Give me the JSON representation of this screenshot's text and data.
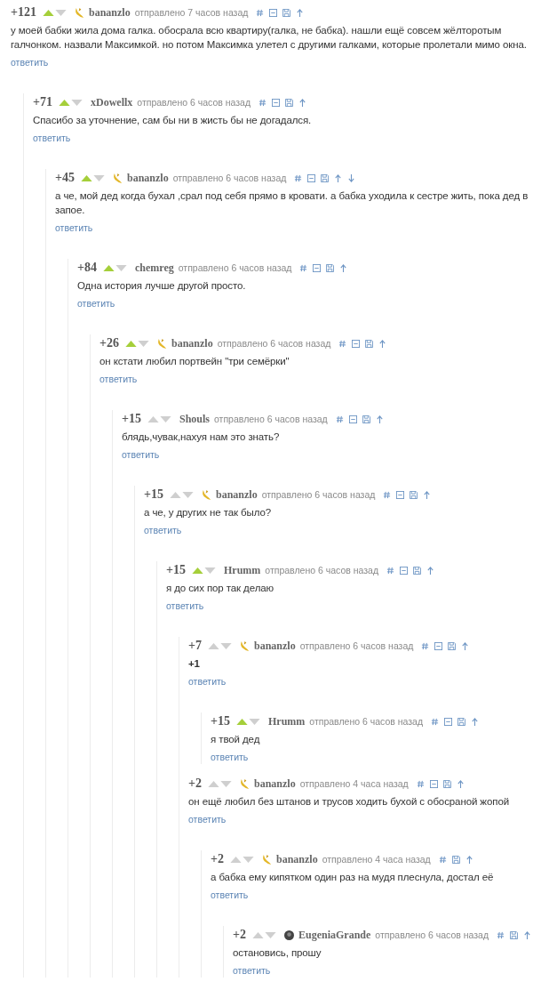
{
  "comments": [
    {
      "score": "+121",
      "upvoted": true,
      "author": "bananzlo",
      "banana": true,
      "time": "отправлено 7 часов назад",
      "collapse": true,
      "text": "у моей бабки жила дома галка. обосрала всю квартиру(галка, не бабка). нашли ещё совсем жёлторотым галчонком. назвали Максимкой. но потом Максимка улетел с другими галками, которые пролетали мимо окна.",
      "reply": "ответить",
      "children": [
        {
          "score": "+71",
          "upvoted": true,
          "author": "xDowellx",
          "time": "отправлено 6 часов назад",
          "collapse": true,
          "text": "Спасибо за уточнение, сам бы ни в жисть бы не догадался.",
          "reply": "ответить",
          "children": [
            {
              "score": "+45",
              "upvoted": true,
              "author": "bananzlo",
              "banana": true,
              "time": "отправлено 6 часов назад",
              "collapse": true,
              "next": true,
              "text": "а че, мой дед когда бухал ,срал под себя прямо в кровати. а бабка уходила к сестре жить, пока дед в запое.",
              "reply": "ответить",
              "children": [
                {
                  "score": "+84",
                  "upvoted": true,
                  "author": "chemreg",
                  "time": "отправлено 6 часов назад",
                  "collapse": true,
                  "text": "Одна история лучше другой просто.",
                  "reply": "ответить",
                  "children": [
                    {
                      "score": "+26",
                      "upvoted": true,
                      "author": "bananzlo",
                      "banana": true,
                      "time": "отправлено 6 часов назад",
                      "collapse": true,
                      "text": "он кстати любил портвейн \"три семёрки\"",
                      "reply": "ответить",
                      "children": [
                        {
                          "score": "+15",
                          "upvoted": false,
                          "author": "Shouls",
                          "time": "отправлено 6 часов назад",
                          "collapse": true,
                          "text": "блядь,чувак,нахуя нам это знать?",
                          "reply": "ответить",
                          "children": [
                            {
                              "score": "+15",
                              "upvoted": false,
                              "author": "bananzlo",
                              "banana": true,
                              "time": "отправлено 6 часов назад",
                              "collapse": true,
                              "text": "а че, у других не так было?",
                              "reply": "ответить",
                              "children": [
                                {
                                  "score": "+15",
                                  "upvoted": true,
                                  "author": "Hrumm",
                                  "time": "отправлено 6 часов назад",
                                  "collapse": true,
                                  "text": "я до сих пор так делаю",
                                  "reply": "ответить",
                                  "children": [
                                    {
                                      "score": "+7",
                                      "upvoted": false,
                                      "author": "bananzlo",
                                      "banana": true,
                                      "time": "отправлено 6 часов назад",
                                      "collapse": true,
                                      "text": "+1",
                                      "bold": true,
                                      "reply": "ответить",
                                      "children": [
                                        {
                                          "score": "+15",
                                          "upvoted": true,
                                          "author": "Hrumm",
                                          "time": "отправлено 6 часов назад",
                                          "collapse": true,
                                          "text": "я твой дед",
                                          "reply": "ответить"
                                        }
                                      ]
                                    },
                                    {
                                      "score": "+2",
                                      "upvoted": false,
                                      "author": "bananzlo",
                                      "banana": true,
                                      "time": "отправлено 4 часа назад",
                                      "collapse": true,
                                      "text": "он ещё любил без штанов и трусов ходить бухой с обосраной жопой",
                                      "reply": "ответить",
                                      "children": [
                                        {
                                          "score": "+2",
                                          "upvoted": false,
                                          "author": "bananzlo",
                                          "banana": true,
                                          "time": "отправлено 4 часа назад",
                                          "text": "а бабка ему кипятком один раз на мудя плеснула, достал её",
                                          "reply": "ответить",
                                          "children": [
                                            {
                                              "score": "+2",
                                              "upvoted": false,
                                              "author": "EugeniaGrande",
                                              "avatar": true,
                                              "time": "отправлено 6 часов назад",
                                              "text": "остановись, прошу",
                                              "reply": "ответить"
                                            }
                                          ]
                                        }
                                      ]
                                    }
                                  ]
                                }
                              ]
                            }
                          ]
                        }
                      ]
                    }
                  ]
                }
              ]
            }
          ]
        }
      ]
    }
  ]
}
